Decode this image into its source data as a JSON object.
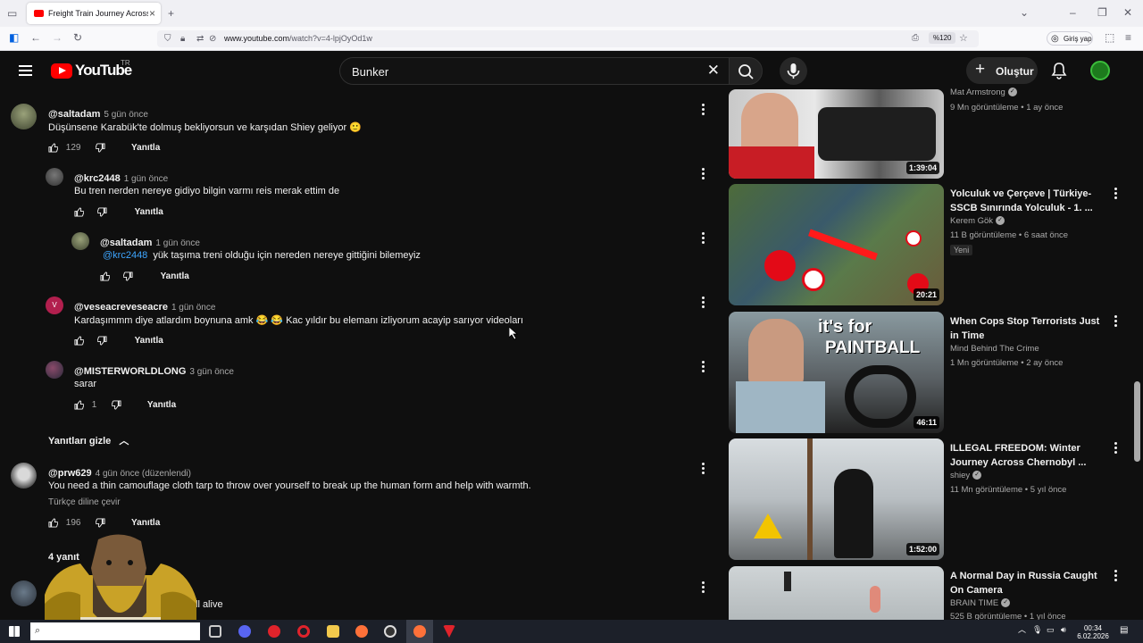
{
  "browser": {
    "tab_title": "Freight Train Journey Across No",
    "url_host": "www.youtube.com",
    "url_path": "/watch?v=4-lpjOyOd1w",
    "zoom": "%120",
    "signin_label": "Giriş yap"
  },
  "header": {
    "logo_text": "YouTube",
    "country_code": "TR",
    "search_value": "Bunker",
    "create_label": "Oluştur"
  },
  "comments": [
    {
      "author": "@saltadam",
      "time": "5 gün önce",
      "text": "Düşünsene Karabük'te dolmuş bekliyorsun ve karşıdan Shiey geliyor 🙂",
      "likes": "129",
      "reply": "Yanıtla"
    },
    {
      "author": "@krc2448",
      "time": "1 gün önce",
      "text": "Bu tren nerden nereye gidiyo bilgin varmı reis merak ettim de",
      "likes": "",
      "reply": "Yanıtla"
    },
    {
      "author": "@saltadam",
      "time": "1 gün önce",
      "mention": "@krc2448",
      "text": "yük taşıma treni olduğu için nereden nereye gittiğini bilemeyiz",
      "likes": "",
      "reply": "Yanıtla"
    },
    {
      "author": "@veseacreveseacre",
      "avatar_letter": "V",
      "time": "1 gün önce",
      "text": "Kardaşımmm diye atlardım boynuna amk 😂 😂  Kac yıldır bu elemanı izliyorum acayip sarıyor videoları",
      "likes": "",
      "reply": "Yanıtla"
    },
    {
      "author": "@MISTERWORLDLONG",
      "time": "3 gün önce",
      "text": "sarar",
      "likes": "1",
      "reply": "Yanıtla"
    },
    {
      "author": "@prw629",
      "time": "4 gün önce (düzenlendi)",
      "text": "You need a thin camouflage cloth tarp to throw over yourself to break up the human form and help with warmth.",
      "translate": "Türkçe diline çevir",
      "likes": "196",
      "reply": "Yanıtla"
    }
  ],
  "hide_replies_label": "Yanıtları gizle",
  "replies_count_label": "4 yanıt",
  "partial_comment_text": "still alive",
  "videos": [
    {
      "title": "",
      "channel": "Mat Armstrong",
      "verified": true,
      "views": "9 Mn görüntüleme",
      "age": "1 ay önce",
      "duration": "1:39:04"
    },
    {
      "title": "Yolculuk ve Çerçeve | Türkiye-SSCB Sınırında Yolculuk - 1. ...",
      "channel": "Kerem Gök",
      "verified": true,
      "views": "11 B görüntüleme",
      "age": "6 saat önce",
      "badge": "Yeni",
      "duration": "20:21"
    },
    {
      "title": "When Cops Stop Terrorists Just in Time",
      "channel": "Mind Behind The Crime",
      "verified": false,
      "views": "1 Mn görüntüleme",
      "age": "2 ay önce",
      "duration": "46:11",
      "thumb_text_1": "it's for",
      "thumb_text_2": "PAINTBALL"
    },
    {
      "title": "ILLEGAL FREEDOM: Winter Journey Across Chernobyl ...",
      "channel": "shiey",
      "verified": true,
      "views": "11 Mn görüntüleme",
      "age": "5 yıl önce",
      "duration": "1:52:00"
    },
    {
      "title": "A Normal Day in Russia Caught On Camera",
      "channel": "BRAIN TIME",
      "verified": true,
      "views": "525 B görüntüleme",
      "age": "1 yıl önce",
      "duration": ""
    }
  ],
  "taskbar": {
    "time": "00:34",
    "date": "6.02.2026"
  },
  "colors": {
    "bg": "#0f0f0f",
    "accent_red": "#ff0000",
    "link_blue": "#3ea6ff",
    "secondary_text": "#aaaaaa"
  }
}
